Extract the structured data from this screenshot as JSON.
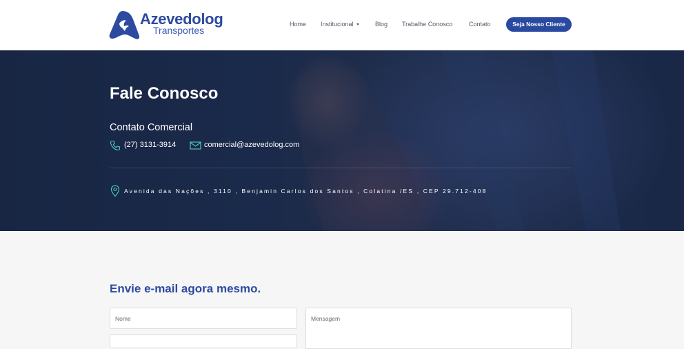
{
  "brand": {
    "name": "Azevedolog",
    "tagline": "Transportes",
    "primary_color": "#2a49a0",
    "logo_icon": "rabbit-mark-icon"
  },
  "nav": {
    "items": [
      {
        "label": "Home"
      },
      {
        "label": "Institucional",
        "has_dropdown": true
      },
      {
        "label": "Blog"
      },
      {
        "label": "Trabalhe Conosco"
      },
      {
        "label": "Contato"
      }
    ],
    "cta_label": "Seja Nosso Cliente"
  },
  "hero": {
    "title": "Fale Conosco",
    "subtitle": "Contato Comercial",
    "phone": "(27) 3131-3914",
    "email": "comercial@azevedolog.com",
    "address": "Avenida das Nações , 3110 , Benjamin Carlos dos Santos , Colatina /ES , CEP 29.712-408",
    "icon_color": "#4fd1c5"
  },
  "form": {
    "title": "Envie e-mail agora mesmo.",
    "name_placeholder": "Nome",
    "message_placeholder": "Mensagem"
  }
}
